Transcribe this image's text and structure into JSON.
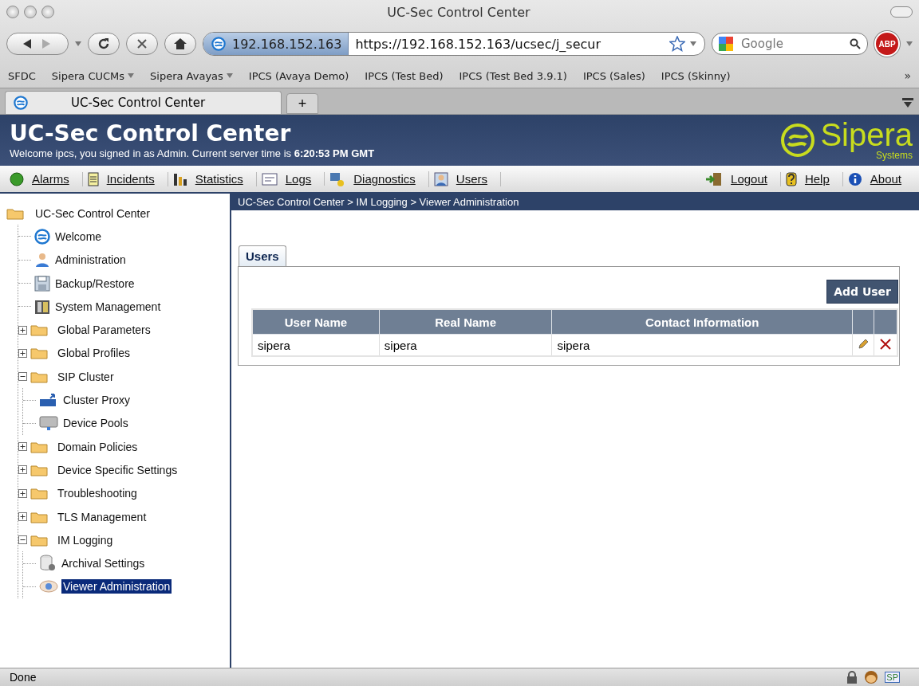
{
  "window": {
    "title": "UC-Sec Control Center"
  },
  "toolbar": {
    "site_identity": "192.168.152.163",
    "url": "https://192.168.152.163/ucsec/j_secur",
    "search": {
      "placeholder": "Google"
    },
    "adblock_label": "ABP"
  },
  "bookmarks": [
    {
      "label": "SFDC",
      "kind": "link"
    },
    {
      "label": "Sipera CUCMs",
      "kind": "menu"
    },
    {
      "label": "Sipera Avayas",
      "kind": "menu"
    },
    {
      "label": "IPCS (Avaya Demo)",
      "kind": "link"
    },
    {
      "label": "IPCS (Test Bed)",
      "kind": "link"
    },
    {
      "label": "IPCS (Test Bed 3.9.1)",
      "kind": "link"
    },
    {
      "label": "IPCS (Sales)",
      "kind": "link"
    },
    {
      "label": "IPCS (Skinny)",
      "kind": "link"
    }
  ],
  "bookmarks_overflow": "»",
  "browser_tabs": [
    {
      "label": "UC-Sec Control Center",
      "selected": true
    }
  ],
  "new_tab": "+",
  "header": {
    "title": "UC-Sec Control Center",
    "welcome": "Welcome ipcs, you signed in as Admin. Current server time is **6:20:53 PM GMT**",
    "logo": "Sipera",
    "logo_sub": "Systems"
  },
  "nav": [
    {
      "label": "Alarms"
    },
    {
      "label": "Incidents"
    },
    {
      "label": "Statistics"
    },
    {
      "label": "Logs"
    },
    {
      "label": "Diagnostics"
    },
    {
      "label": "Users"
    },
    {
      "label": "Logout"
    },
    {
      "label": "Help"
    },
    {
      "label": "About"
    }
  ],
  "tree": {
    "label": "UC-Sec Control Center",
    "selected": false,
    "children": [
      {
        "label": "Welcome",
        "kind": "leaf",
        "selected": false
      },
      {
        "label": "Administration",
        "kind": "leaf",
        "selected": false
      },
      {
        "label": "Backup/Restore",
        "kind": "leaf",
        "selected": false
      },
      {
        "label": "System Management",
        "kind": "leaf",
        "selected": false
      },
      {
        "label": "Global Parameters",
        "kind": "folder",
        "expanded": false,
        "selected": false
      },
      {
        "label": "Global Profiles",
        "kind": "folder",
        "expanded": false,
        "selected": false
      },
      {
        "label": "SIP Cluster",
        "kind": "folder",
        "expanded": true,
        "selected": false,
        "children": [
          {
            "label": "Cluster Proxy",
            "kind": "leaf",
            "selected": false
          },
          {
            "label": "Device Pools",
            "kind": "leaf",
            "selected": false
          }
        ]
      },
      {
        "label": "Domain Policies",
        "kind": "folder",
        "expanded": false,
        "selected": false
      },
      {
        "label": "Device Specific Settings",
        "kind": "folder",
        "expanded": false,
        "selected": false
      },
      {
        "label": "Troubleshooting",
        "kind": "folder",
        "expanded": false,
        "selected": false
      },
      {
        "label": "TLS Management",
        "kind": "folder",
        "expanded": false,
        "selected": false
      },
      {
        "label": "IM Logging",
        "kind": "folder",
        "expanded": true,
        "selected": false,
        "children": [
          {
            "label": "Archival Settings",
            "kind": "leaf",
            "selected": false
          },
          {
            "label": "Viewer Administration",
            "kind": "leaf",
            "selected": true
          }
        ]
      }
    ]
  },
  "breadcrumb": "UC-Sec Control Center > IM Logging > Viewer Administration",
  "panel_tabs": [
    {
      "label": "Users",
      "selected": true
    }
  ],
  "add_button": "Add User",
  "table": {
    "columns": [
      "User Name",
      "Real Name",
      "Contact Information"
    ],
    "rows": [
      {
        "cells": [
          "sipera",
          "sipera",
          "sipera"
        ]
      }
    ]
  },
  "status_bar": {
    "text": "Done",
    "badge": "SP"
  }
}
